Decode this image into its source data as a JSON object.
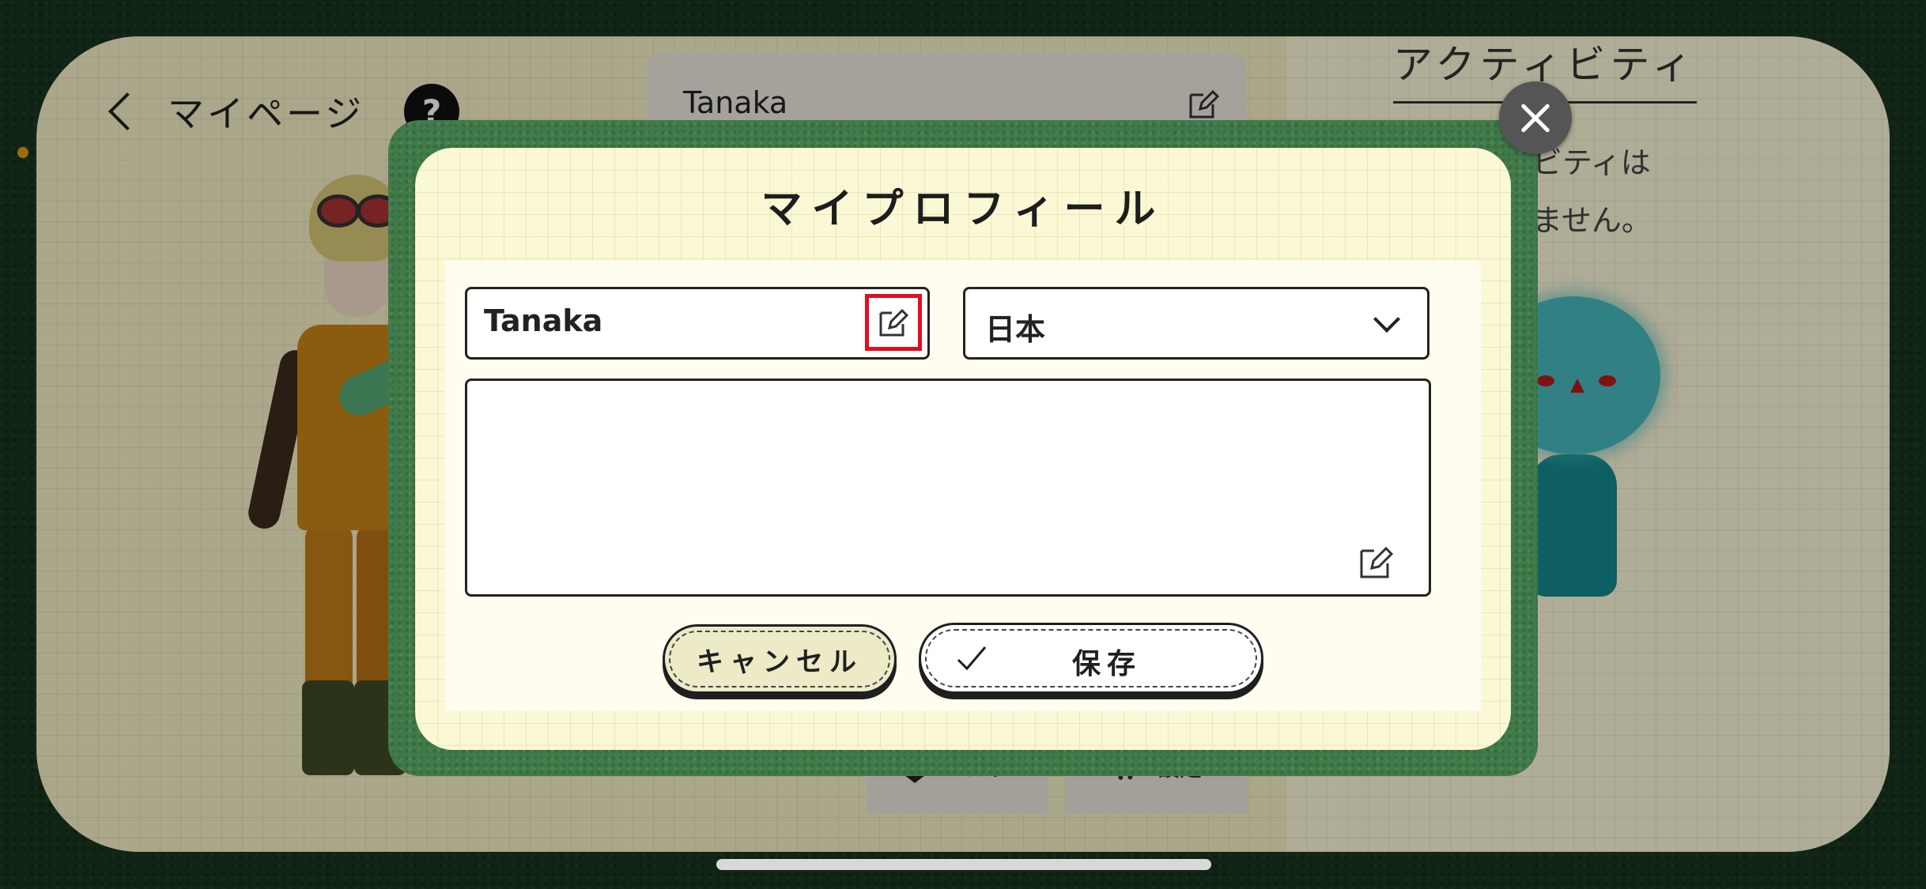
{
  "background_page": {
    "header": {
      "title": "マイページ",
      "help_glyph": "?"
    },
    "profile_card": {
      "name": "Tanaka"
    },
    "activity": {
      "title": "アクティビティ",
      "empty_line1": "ィビティは",
      "empty_line2": "りません。"
    },
    "bottom_nav": {
      "help_label": "ヘルプ",
      "settings_label": "設定"
    }
  },
  "modal": {
    "title": "マイプロフィール",
    "name_field": {
      "value": "Tanaka"
    },
    "country_select": {
      "selected": "日本"
    },
    "bio_field": {
      "value": ""
    },
    "buttons": {
      "cancel_label": "キャンセル",
      "save_label": "保存"
    }
  },
  "colors": {
    "highlight": "#e10e1e",
    "modal_frame": "#3f7a48",
    "paper": "#fbf8d6"
  },
  "icons": [
    "back-icon",
    "help-icon",
    "edit-icon",
    "chevron-down-icon",
    "check-icon",
    "close-icon",
    "beginner-mark-icon",
    "gear-icon"
  ]
}
